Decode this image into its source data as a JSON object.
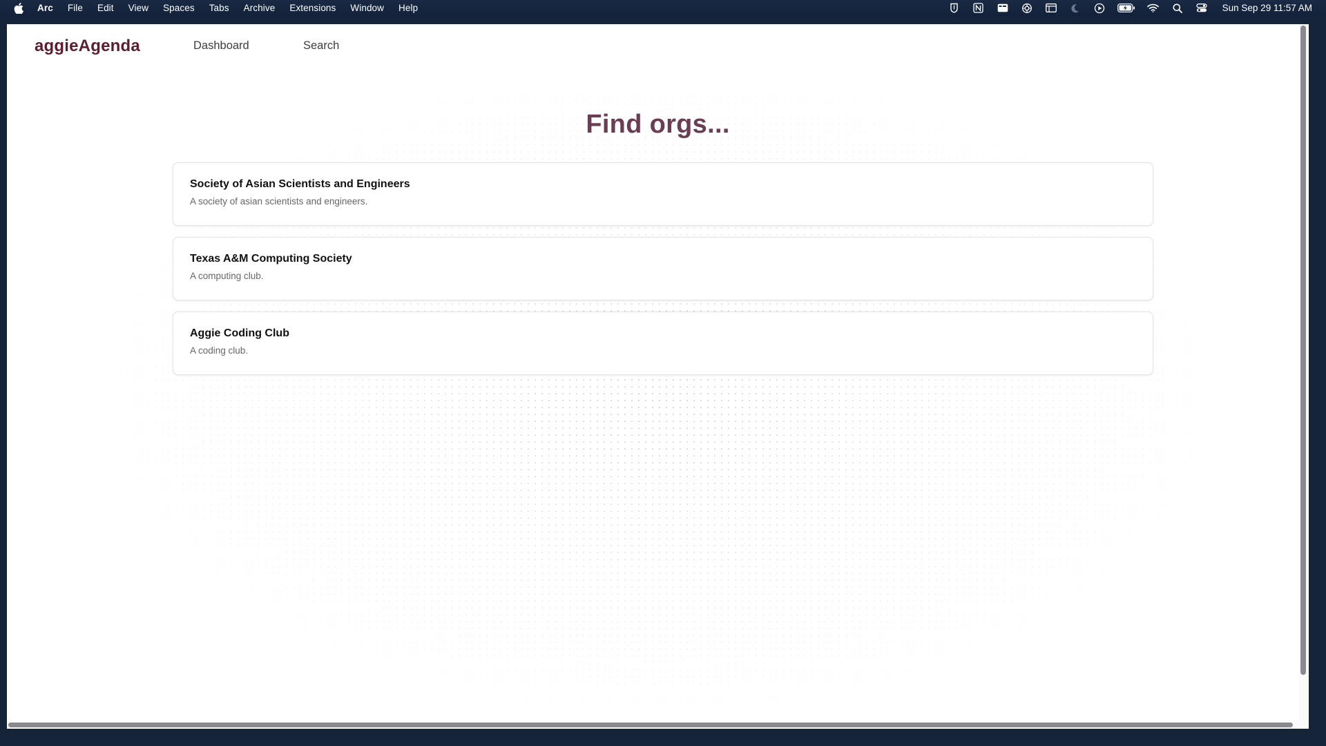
{
  "menubar": {
    "icon": "apple-icon",
    "items": [
      {
        "label": "Arc"
      },
      {
        "label": "File"
      },
      {
        "label": "Edit"
      },
      {
        "label": "View"
      },
      {
        "label": "Spaces"
      },
      {
        "label": "Tabs"
      },
      {
        "label": "Archive"
      },
      {
        "label": "Extensions"
      },
      {
        "label": "Window"
      },
      {
        "label": "Help"
      }
    ],
    "tray_icons": [
      "shield-icon",
      "notion-icon",
      "card-icon",
      "chatgpt-icon",
      "window-icon",
      "moon-icon",
      "play-icon",
      "battery-icon",
      "wifi-icon",
      "search-icon",
      "control-center-icon"
    ],
    "clock": "Sun Sep 29  11:57 AM"
  },
  "nav": {
    "brand": "aggieAgenda",
    "links": [
      {
        "label": "Dashboard"
      },
      {
        "label": "Search"
      }
    ]
  },
  "main": {
    "title": "Find orgs...",
    "orgs": [
      {
        "name": "Society of Asian Scientists and Engineers",
        "description": "A society of asian scientists and engineers."
      },
      {
        "name": "Texas A&M Computing Society",
        "description": "A computing club."
      },
      {
        "name": "Aggie Coding Club",
        "description": "A coding club."
      }
    ]
  },
  "colors": {
    "brand": "#5c1e2f",
    "title": "#6b3d54",
    "menubar": "#16243a"
  }
}
